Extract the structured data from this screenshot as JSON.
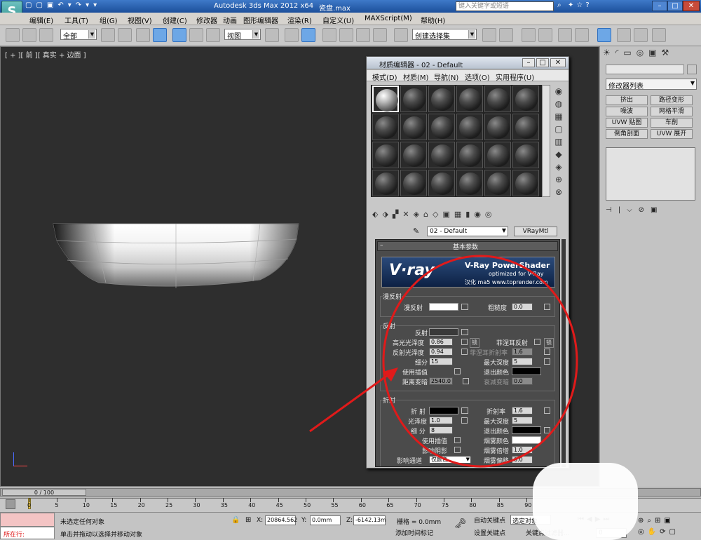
{
  "app": {
    "title": "Autodesk 3ds Max  2012 x64",
    "file": "瓷盘.max",
    "search_placeholder": "键入关键字或短语"
  },
  "menu": [
    "编辑(E)",
    "工具(T)",
    "组(G)",
    "视图(V)",
    "创建(C)",
    "修改器",
    "动画",
    "图形编辑器",
    "渲染(R)",
    "自定义(U)",
    "MAXScript(M)",
    "帮助(H)"
  ],
  "toolbar": {
    "filter": "全部",
    "refcoord": "视图",
    "selset": "创建选择集"
  },
  "viewport": {
    "label": "[ + ][ 前 ][ 真实 + 边面 ]"
  },
  "cmdpanel": {
    "modifier_list": "修改器列表",
    "buttons": [
      "挤出",
      "路径变形",
      "噪波",
      "网格平滑",
      "UVW 贴图",
      "车削",
      "倒角剖面",
      "UVW 展开"
    ]
  },
  "material_editor": {
    "title": "材质编辑器 - 02 - Default",
    "menu": [
      "模式(D)",
      "材质(M)",
      "导航(N)",
      "选项(O)",
      "实用程序(U)"
    ],
    "material_name": "02 - Default",
    "material_type": "VRayMtl",
    "rollout_title": "基本参数",
    "banner": {
      "logo": "V·ray",
      "headline": "V-Ray PowerShader",
      "sub": "optimized for V-Ray",
      "credit": "汉化 ma5 www.toprender.com"
    },
    "diffuse": {
      "group": "漫反射",
      "label": "漫反射",
      "roughness_label": "粗糙度",
      "roughness": "0.0",
      "color": "#ffffff"
    },
    "reflection": {
      "group": "反射",
      "reflect_label": "反射",
      "hilight_gloss_label": "高光光泽度",
      "hilight_gloss": "0.86",
      "refl_gloss_label": "反射光泽度",
      "refl_gloss": "0.94",
      "subdivs_label": "细分",
      "subdivs": "15",
      "use_interp_label": "使用插值",
      "dim_dist_label": "距离变暗",
      "dim_dist": "2540.0",
      "fresnel_label": "菲涅耳反射",
      "fresnel_ior_label": "菲涅耳折射率",
      "fresnel_ior": "1.6",
      "max_depth_label": "最大深度",
      "max_depth": "5",
      "exit_color_label": "退出颜色",
      "dim_falloff_label": "衰减变暗",
      "dim_falloff": "0.0",
      "lock": "锁",
      "reflect_color": "#3a3a3a",
      "exit_color": "#000000"
    },
    "refraction": {
      "group": "折射",
      "refract_label": "折 射",
      "gloss_label": "光泽度",
      "gloss": "1.0",
      "subdivs_label": "细 分",
      "subdivs": "8",
      "use_interp_label": "使用插值",
      "affect_shadows_label": "影响阴影",
      "affect_channels_label": "影响通道",
      "affect_channels": "仅颜色",
      "ior_label": "折射率",
      "ior": "1.6",
      "max_depth_label": "最大深度",
      "max_depth": "5",
      "exit_color_label": "退出颜色",
      "fog_color_label": "烟雾颜色",
      "fog_mult_label": "烟雾倍增",
      "fog_mult": "1.0",
      "fog_bias_label": "烟雾偏移",
      "fog_bias": "0.0",
      "refract_color": "#000000",
      "fog_color": "#ffffff"
    }
  },
  "timeline": {
    "frame": "0 / 100",
    "ticks": [
      "0",
      "5",
      "10",
      "15",
      "20",
      "25",
      "30",
      "35",
      "40",
      "45",
      "50",
      "55",
      "60",
      "65",
      "70",
      "75",
      "80",
      "85",
      "90"
    ]
  },
  "status": {
    "mode": "所在行:",
    "selection": "未选定任何对象",
    "prompt": "单击并拖动以选择并移动对象",
    "x_label": "X:",
    "x": "20864.562",
    "y_label": "Y:",
    "y": "0.0mm",
    "z_label": "Z:",
    "z": "-6142.13m",
    "grid": "栅格 = 0.0mm",
    "add_tag": "添加时间标记",
    "autokey": "自动关键点",
    "selected": "选定对象",
    "setkey": "设置关键点",
    "filters": "关键点过滤器...",
    "frame_field": "0"
  }
}
